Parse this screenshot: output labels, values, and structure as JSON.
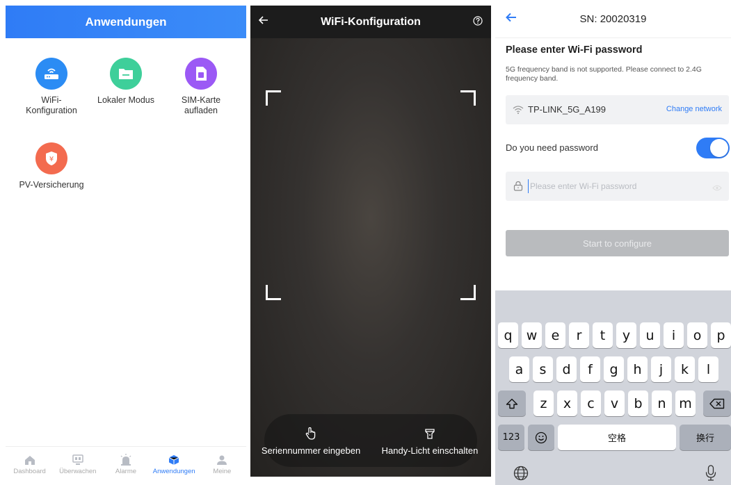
{
  "panel1": {
    "header_title": "Anwendungen",
    "apps": [
      {
        "label": "WiFi-\nKonfiguration",
        "icon": "router-icon",
        "color": "#2b8cf4"
      },
      {
        "label": "Lokaler Modus",
        "icon": "folder-icon",
        "color": "#3ecf9a"
      },
      {
        "label": "SIM-Karte\naufladen",
        "icon": "sim-card-icon",
        "color": "#9b59f5"
      },
      {
        "label": "PV-Versicherung",
        "icon": "insurance-shield-icon",
        "color": "#f36b4f"
      }
    ],
    "tabs": [
      {
        "label": "Dashboard",
        "icon": "home-icon",
        "active": false
      },
      {
        "label": "Überwachen",
        "icon": "monitor-icon",
        "active": false
      },
      {
        "label": "Alarme",
        "icon": "alarm-icon",
        "active": false
      },
      {
        "label": "Anwendungen",
        "icon": "cube-icon",
        "active": true
      },
      {
        "label": "Meine",
        "icon": "user-icon",
        "active": false
      }
    ]
  },
  "panel2": {
    "header_title": "WiFi-Konfiguration",
    "enter_serial_label": "Seriennummer eingeben",
    "flashlight_label": "Handy-Licht einschalten"
  },
  "panel3": {
    "header_title": "SN: 20020319",
    "title": "Please enter Wi-Fi password",
    "note": "5G frequency band is not supported. Please connect to 2.4G frequency band.",
    "ssid": "TP-LINK_5G_A199",
    "change_network": "Change network",
    "need_password_label": "Do you need password",
    "need_password": true,
    "password_placeholder": "Please enter Wi-Fi password",
    "password_value": "",
    "start_label": "Start to configure"
  },
  "keyboard": {
    "row1": [
      "q",
      "w",
      "e",
      "r",
      "t",
      "y",
      "u",
      "i",
      "o",
      "p"
    ],
    "row2": [
      "a",
      "s",
      "d",
      "f",
      "g",
      "h",
      "j",
      "k",
      "l"
    ],
    "row3": [
      "z",
      "x",
      "c",
      "v",
      "b",
      "n",
      "m"
    ],
    "numbers_key": "123",
    "space_key": "空格",
    "return_key": "换行"
  },
  "colors": {
    "accent": "#2f7cf6",
    "scanner_bg": "#2e2b28",
    "disabled_button": "#b9bbbe"
  }
}
